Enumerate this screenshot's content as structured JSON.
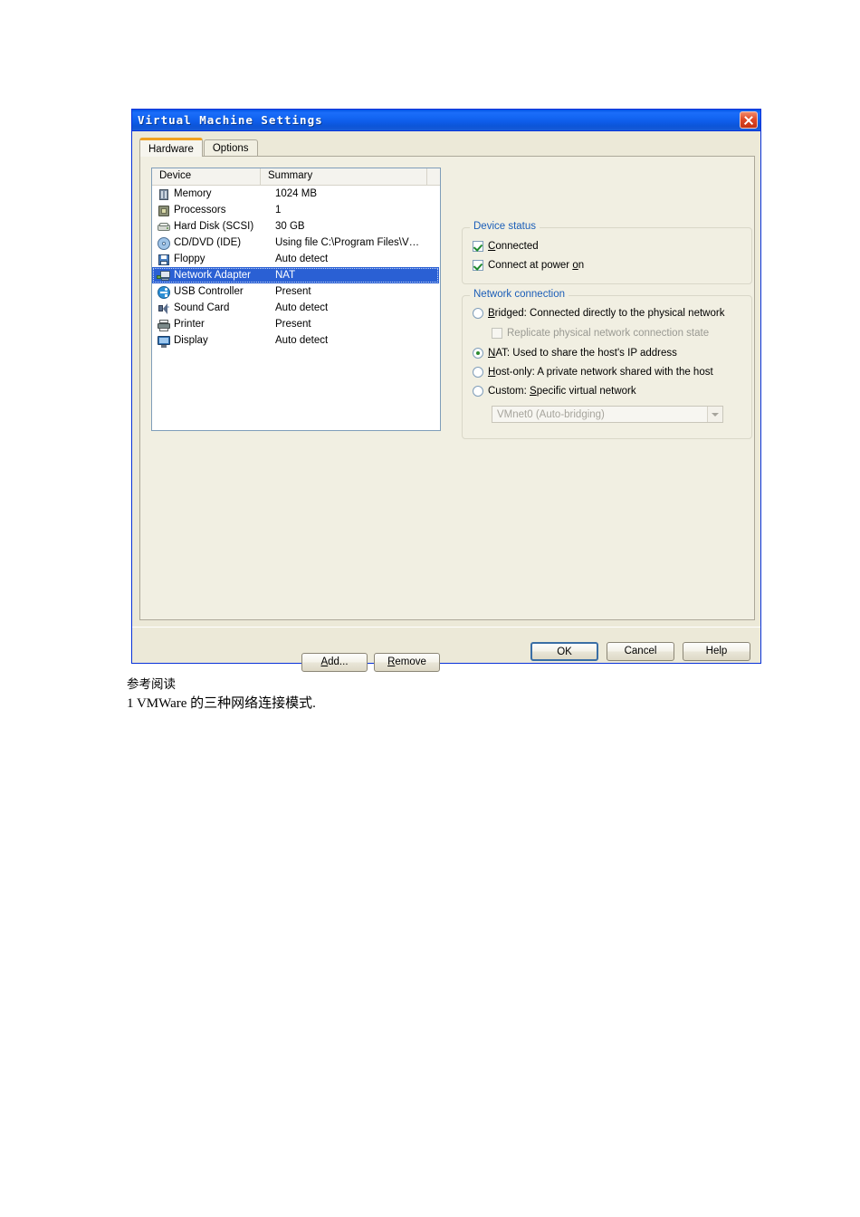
{
  "window": {
    "title": "Virtual Machine Settings",
    "close_icon": "close-icon"
  },
  "tabs": [
    {
      "label": "Hardware",
      "active": true
    },
    {
      "label": "Options",
      "active": false
    }
  ],
  "device_list": {
    "columns": [
      "Device",
      "Summary"
    ],
    "rows": [
      {
        "icon": "memory-icon",
        "device": "Memory",
        "summary": "1024 MB",
        "selected": false
      },
      {
        "icon": "processor-icon",
        "device": "Processors",
        "summary": "1",
        "selected": false
      },
      {
        "icon": "hard-disk-icon",
        "device": "Hard Disk (SCSI)",
        "summary": "30 GB",
        "selected": false
      },
      {
        "icon": "cd-dvd-icon",
        "device": "CD/DVD (IDE)",
        "summary": "Using file C:\\Program Files\\V…",
        "selected": false
      },
      {
        "icon": "floppy-icon",
        "device": "Floppy",
        "summary": "Auto detect",
        "selected": false
      },
      {
        "icon": "network-adapter-icon",
        "device": "Network Adapter",
        "summary": "NAT",
        "selected": true
      },
      {
        "icon": "usb-controller-icon",
        "device": "USB Controller",
        "summary": "Present",
        "selected": false
      },
      {
        "icon": "sound-card-icon",
        "device": "Sound Card",
        "summary": "Auto detect",
        "selected": false
      },
      {
        "icon": "printer-icon",
        "device": "Printer",
        "summary": "Present",
        "selected": false
      },
      {
        "icon": "display-icon",
        "device": "Display",
        "summary": "Auto detect",
        "selected": false
      }
    ]
  },
  "list_buttons": {
    "add": "Add...",
    "remove": "Remove"
  },
  "device_status": {
    "group_label": "Device status",
    "connected": {
      "label": "Connected",
      "checked": true,
      "enabled": true
    },
    "connect_at_power_on": {
      "label": "Connect at power on",
      "checked": true,
      "enabled": true
    }
  },
  "network_connection": {
    "group_label": "Network connection",
    "options": [
      {
        "label": "Bridged: Connected directly to the physical network",
        "selected": false,
        "enabled": true
      },
      {
        "label": "NAT: Used to share the host's IP address",
        "selected": true,
        "enabled": true
      },
      {
        "label": "Host-only: A private network shared with the host",
        "selected": false,
        "enabled": true
      },
      {
        "label": "Custom: Specific virtual network",
        "selected": false,
        "enabled": true
      }
    ],
    "replicate_checkbox": {
      "label": "Replicate physical network connection state",
      "checked": false,
      "enabled": false
    },
    "custom_network_select": {
      "value": "VMnet0 (Auto-bridging)",
      "enabled": false
    }
  },
  "footer_buttons": {
    "ok": "OK",
    "cancel": "Cancel",
    "help": "Help"
  },
  "document_notes": {
    "line1": "参考阅读",
    "line2": "1 VMWare 的三种网络连接模式."
  },
  "colors": {
    "titlebar_blue": "#0e5ce8",
    "dialog_face": "#ece9d8",
    "tab_page": "#f1efe2",
    "selection_blue": "#2a60d4",
    "group_label_blue": "#1b5eb8",
    "active_tab_accent": "#f0a11e",
    "close_red": "#c33213",
    "check_green": "#1f8a2e"
  }
}
